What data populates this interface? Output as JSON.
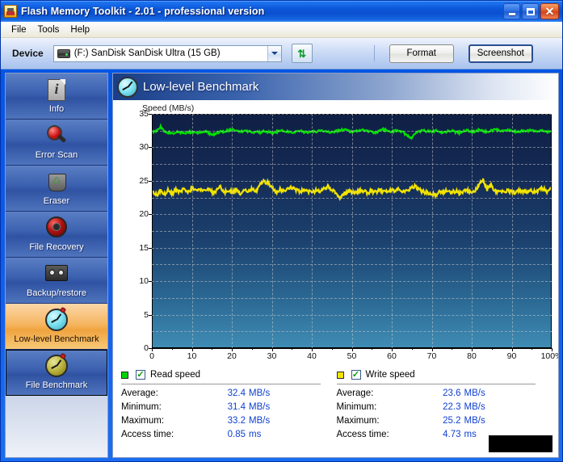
{
  "window": {
    "title": "Flash Memory Toolkit - 2.01 - professional version",
    "icon": "app-flash-icon",
    "controls": {
      "minimize": "_",
      "maximize": "□",
      "close": "✕"
    }
  },
  "menu": {
    "items": [
      "File",
      "Tools",
      "Help"
    ]
  },
  "toolbar": {
    "device_label": "Device",
    "device_value": "(F:) SanDisk SanDisk Ultra (15 GB)",
    "device_icon": "drive-icon",
    "refresh_icon": "refresh-icon",
    "format_label": "Format",
    "screenshot_label": "Screenshot"
  },
  "sidebar": {
    "items": [
      {
        "label": "Info",
        "icon": "info-document-icon",
        "active": false
      },
      {
        "label": "Error Scan",
        "icon": "magnifier-icon",
        "active": false
      },
      {
        "label": "Eraser",
        "icon": "trash-recycle-icon",
        "active": false
      },
      {
        "label": "File Recovery",
        "icon": "lifebuoy-icon",
        "active": false
      },
      {
        "label": "Backup/restore",
        "icon": "tape-cassette-icon",
        "active": false
      },
      {
        "label": "Low-level Benchmark",
        "icon": "stopwatch-cyan-icon",
        "active": true
      },
      {
        "label": "File Benchmark",
        "icon": "stopwatch-olive-icon",
        "active": false
      }
    ]
  },
  "content": {
    "header_title": "Low-level Benchmark",
    "header_icon": "stopwatch-cyan-icon"
  },
  "chart_data": {
    "type": "line",
    "title": "",
    "ylabel": "Speed (MB/s)",
    "xlabel": "",
    "ylim": [
      0,
      35
    ],
    "xlim": [
      0,
      100
    ],
    "yticks": [
      0,
      5,
      10,
      15,
      20,
      25,
      30,
      35
    ],
    "ytick_labels": [
      "0",
      "5",
      "10",
      "15",
      "20",
      "25",
      "30",
      "35"
    ],
    "xticks": [
      0,
      10,
      20,
      30,
      40,
      50,
      60,
      70,
      80,
      90,
      100
    ],
    "xtick_labels": [
      "0",
      "10",
      "20",
      "30",
      "40",
      "50",
      "60",
      "70",
      "80",
      "90",
      "100%"
    ],
    "grid": true,
    "grid_style": "dashed",
    "legend_position": "below",
    "background_gradient": [
      "#0f1f44",
      "#3f8cb4"
    ],
    "series": [
      {
        "name": "Read speed",
        "color": "#00e000",
        "x": [
          0,
          1,
          2,
          3,
          4,
          5,
          6,
          7,
          8,
          9,
          10,
          11,
          12,
          13,
          14,
          15,
          16,
          17,
          18,
          19,
          20,
          21,
          22,
          23,
          24,
          25,
          26,
          27,
          28,
          29,
          30,
          31,
          32,
          33,
          34,
          35,
          36,
          37,
          38,
          39,
          40,
          41,
          42,
          43,
          44,
          45,
          46,
          47,
          48,
          49,
          50,
          51,
          52,
          53,
          54,
          55,
          56,
          57,
          58,
          59,
          60,
          61,
          62,
          63,
          64,
          65,
          66,
          67,
          68,
          69,
          70,
          71,
          72,
          73,
          74,
          75,
          76,
          77,
          78,
          79,
          80,
          81,
          82,
          83,
          84,
          85,
          86,
          87,
          88,
          89,
          90,
          91,
          92,
          93,
          94,
          95,
          96,
          97,
          98,
          99,
          100
        ],
        "values": [
          32.3,
          32.6,
          33.2,
          32.5,
          32.3,
          32.2,
          32.4,
          32.3,
          32.2,
          32.4,
          32.3,
          32.2,
          32.4,
          32.5,
          32.3,
          31.9,
          32.3,
          32.4,
          32.5,
          32.6,
          32.8,
          32.5,
          32.4,
          32.6,
          32.5,
          32.3,
          32.4,
          32.3,
          32.5,
          32.4,
          32.2,
          32.4,
          32.6,
          32.5,
          32.4,
          32.3,
          32.5,
          32.6,
          32.4,
          32.3,
          32.5,
          32.4,
          32.6,
          32.5,
          32.4,
          32.3,
          32.5,
          32.6,
          32.8,
          32.6,
          32.4,
          32.5,
          32.6,
          32.7,
          32.5,
          32.4,
          32.3,
          32.6,
          32.8,
          32.5,
          32.4,
          32.6,
          32.5,
          32.3,
          31.8,
          31.4,
          32.2,
          32.5,
          32.6,
          32.5,
          32.4,
          32.6,
          32.5,
          32.3,
          32.5,
          32.6,
          32.4,
          32.3,
          32.5,
          32.6,
          32.4,
          32.5,
          32.7,
          32.5,
          32.4,
          32.6,
          32.8,
          32.6,
          32.5,
          32.7,
          32.6,
          32.5,
          32.4,
          32.6,
          32.5,
          32.7,
          32.6,
          32.5,
          32.6,
          32.4,
          32.5
        ],
        "stats": {
          "rows": [
            {
              "key": "Average:",
              "value": "32.4",
              "unit": "MB/s"
            },
            {
              "key": "Minimum:",
              "value": "31.4",
              "unit": "MB/s"
            },
            {
              "key": "Maximum:",
              "value": "33.2",
              "unit": "MB/s"
            },
            {
              "key": "Access time:",
              "value": "0.85",
              "unit": "ms"
            }
          ]
        },
        "checked": true
      },
      {
        "name": "Write speed",
        "color": "#f2e300",
        "x": [
          0,
          1,
          2,
          3,
          4,
          5,
          6,
          7,
          8,
          9,
          10,
          11,
          12,
          13,
          14,
          15,
          16,
          17,
          18,
          19,
          20,
          21,
          22,
          23,
          24,
          25,
          26,
          27,
          28,
          29,
          30,
          31,
          32,
          33,
          34,
          35,
          36,
          37,
          38,
          39,
          40,
          41,
          42,
          43,
          44,
          45,
          46,
          47,
          48,
          49,
          50,
          51,
          52,
          53,
          54,
          55,
          56,
          57,
          58,
          59,
          60,
          61,
          62,
          63,
          64,
          65,
          66,
          67,
          68,
          69,
          70,
          71,
          72,
          73,
          74,
          75,
          76,
          77,
          78,
          79,
          80,
          81,
          82,
          83,
          84,
          85,
          86,
          87,
          88,
          89,
          90,
          91,
          92,
          93,
          94,
          95,
          96,
          97,
          98,
          99,
          100
        ],
        "values": [
          23.4,
          22.9,
          23.6,
          23.1,
          23.7,
          23.2,
          23.8,
          23.3,
          23.9,
          23.4,
          24.0,
          23.5,
          23.6,
          23.4,
          23.8,
          23.3,
          23.5,
          24.1,
          23.4,
          23.6,
          23.3,
          23.7,
          23.2,
          23.6,
          23.4,
          23.8,
          23.5,
          24.6,
          25.0,
          24.7,
          23.9,
          23.4,
          23.7,
          23.5,
          23.9,
          24.0,
          23.6,
          23.4,
          23.8,
          23.5,
          23.2,
          23.6,
          23.4,
          23.9,
          24.2,
          23.6,
          23.3,
          22.4,
          23.1,
          23.5,
          23.4,
          23.2,
          23.6,
          23.4,
          23.3,
          23.5,
          23.4,
          23.6,
          23.5,
          23.3,
          23.6,
          23.5,
          23.8,
          23.4,
          23.6,
          23.9,
          24.2,
          23.7,
          23.4,
          23.2,
          22.8,
          23.0,
          23.3,
          23.4,
          23.6,
          23.3,
          23.5,
          23.2,
          23.4,
          23.6,
          23.3,
          23.5,
          24.6,
          25.2,
          23.8,
          24.3,
          23.4,
          23.6,
          23.3,
          23.5,
          23.4,
          23.2,
          23.6,
          23.4,
          23.3,
          23.5,
          23.4,
          23.6,
          23.9,
          23.4,
          24.1
        ],
        "stats": {
          "rows": [
            {
              "key": "Average:",
              "value": "23.6",
              "unit": "MB/s"
            },
            {
              "key": "Minimum:",
              "value": "22.3",
              "unit": "MB/s"
            },
            {
              "key": "Maximum:",
              "value": "25.2",
              "unit": "MB/s"
            },
            {
              "key": "Access time:",
              "value": "4.73",
              "unit": "ms"
            }
          ]
        },
        "checked": true
      }
    ]
  },
  "colors": {
    "read": "#00d600",
    "write": "#f2e300",
    "value_text": "#1040d0",
    "accent": "#0055e5",
    "selected_item": "#f0a33f"
  }
}
